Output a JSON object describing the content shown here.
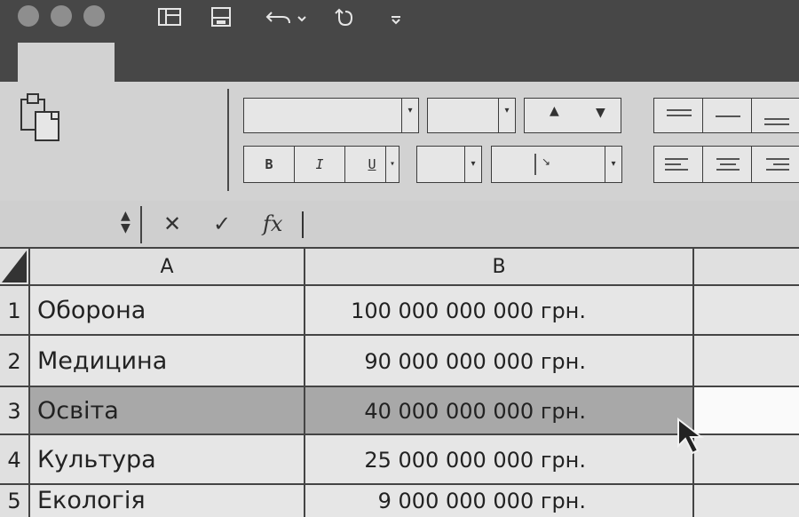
{
  "toolbar": {
    "quick_access": [
      "layout-icon",
      "save-icon",
      "undo-icon",
      "redo-icon",
      "customize-icon"
    ],
    "format_buttons": {
      "bold": "B",
      "italic": "I",
      "underline": "U"
    },
    "formula_icons": {
      "cancel": "✕",
      "confirm": "✓",
      "function": "fx"
    }
  },
  "formula_bar": {
    "name_box_value": "",
    "formula_value": ""
  },
  "columns": [
    "A",
    "B"
  ],
  "rows": [
    {
      "num": "1",
      "a": "Оборона",
      "b": "100 000 000 000 грн."
    },
    {
      "num": "2",
      "a": "Медицина",
      "b": "90 000 000 000 грн."
    },
    {
      "num": "3",
      "a": "Освіта",
      "b": "40 000 000 000 грн."
    },
    {
      "num": "4",
      "a": "Культура",
      "b": "25 000 000 000 грн."
    },
    {
      "num": "5",
      "a": "Екологія",
      "b": "9 000 000 000 грн."
    }
  ],
  "selection": {
    "row": "3"
  },
  "colors": {
    "titlebar": "#474747",
    "selected_row": "#a8a8a8",
    "grid_line": "#444444"
  }
}
